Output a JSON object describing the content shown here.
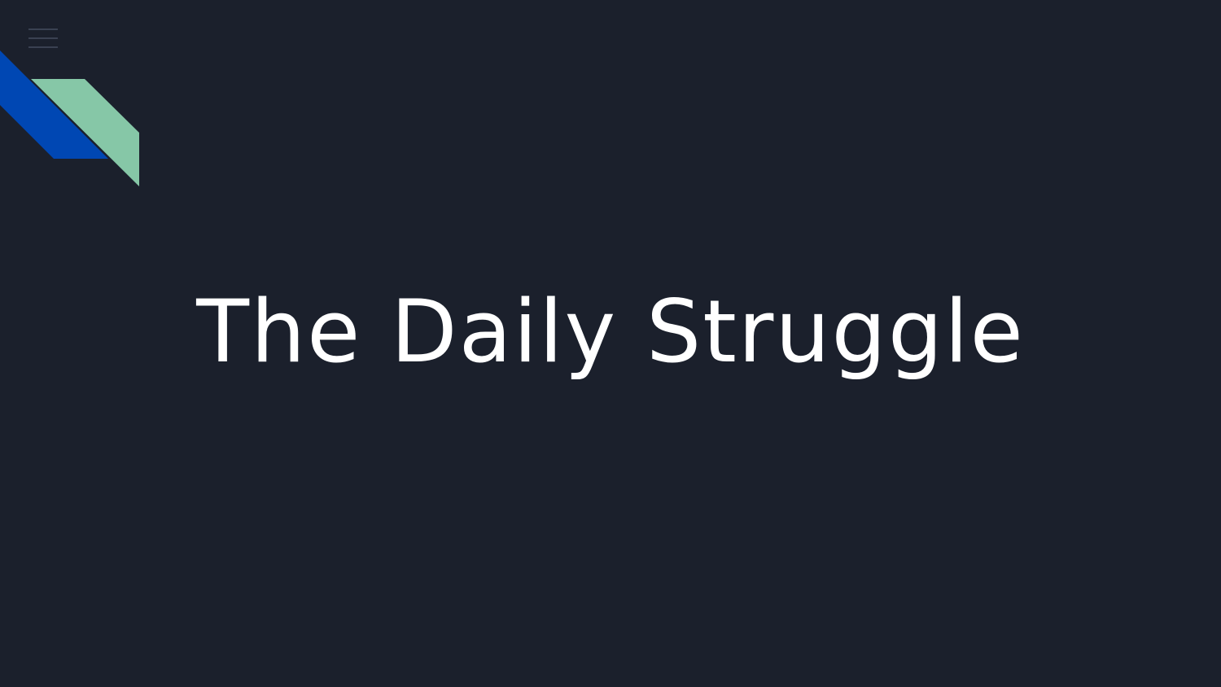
{
  "slide": {
    "title": "The Daily Struggle",
    "background_color": "#1b202c",
    "title_color": "#ffffff"
  },
  "menu": {
    "icon": "hamburger-menu-icon",
    "color": "#3a4152"
  },
  "decoration": {
    "icon": "diagonal-stripes-icon",
    "colors": [
      "#0047b3",
      "#86c7a7"
    ]
  }
}
